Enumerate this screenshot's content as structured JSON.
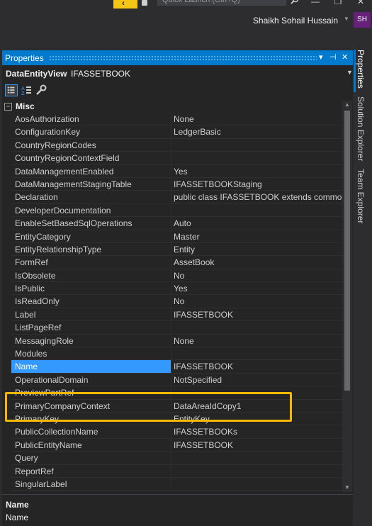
{
  "titlebar": {
    "quick_launch_placeholder": "Quick Launch (Ctrl+Q)",
    "user_name": "Shaikh Sohail Hussain",
    "user_initials": "SH"
  },
  "panel": {
    "title": "Properties",
    "object_name": "DataEntityView",
    "object_type": "IFASSETBOOK",
    "category": "Misc",
    "properties": [
      {
        "name": "AosAuthorization",
        "value": "None"
      },
      {
        "name": "ConfigurationKey",
        "value": "LedgerBasic"
      },
      {
        "name": "CountryRegionCodes",
        "value": ""
      },
      {
        "name": "CountryRegionContextField",
        "value": ""
      },
      {
        "name": "DataManagementEnabled",
        "value": "Yes"
      },
      {
        "name": "DataManagementStagingTable",
        "value": "IFASSETBOOKStaging"
      },
      {
        "name": "Declaration",
        "value": "public class IFASSETBOOK extends common{"
      },
      {
        "name": "DeveloperDocumentation",
        "value": ""
      },
      {
        "name": "EnableSetBasedSqlOperations",
        "value": "Auto"
      },
      {
        "name": "EntityCategory",
        "value": "Master"
      },
      {
        "name": "EntityRelationshipType",
        "value": "Entity"
      },
      {
        "name": "FormRef",
        "value": "AssetBook"
      },
      {
        "name": "IsObsolete",
        "value": "No"
      },
      {
        "name": "IsPublic",
        "value": "Yes"
      },
      {
        "name": "IsReadOnly",
        "value": "No"
      },
      {
        "name": "Label",
        "value": "IFASSETBOOK"
      },
      {
        "name": "ListPageRef",
        "value": ""
      },
      {
        "name": "MessagingRole",
        "value": "None"
      },
      {
        "name": "Modules",
        "value": ""
      },
      {
        "name": "Name",
        "value": "IFASSETBOOK"
      },
      {
        "name": "OperationalDomain",
        "value": "NotSpecified"
      },
      {
        "name": "PreviewPartRef",
        "value": ""
      },
      {
        "name": "PrimaryCompanyContext",
        "value": "DataAreaIdCopy1"
      },
      {
        "name": "PrimaryKey",
        "value": "EntityKey"
      },
      {
        "name": "PublicCollectionName",
        "value": "IFASSETBOOKs"
      },
      {
        "name": "PublicEntityName",
        "value": "IFASSETBOOK"
      },
      {
        "name": "Query",
        "value": ""
      },
      {
        "name": "ReportRef",
        "value": ""
      },
      {
        "name": "SingularLabel",
        "value": ""
      }
    ],
    "selected_property": "Name",
    "description_title": "Name",
    "description_text": "Name"
  },
  "side_tabs": [
    "Properties",
    "Solution Explorer",
    "Team Explorer"
  ],
  "colors": {
    "accent": "#007acc",
    "selection": "#3399ff",
    "highlight_box": "#f5b800",
    "background": "#252526"
  }
}
